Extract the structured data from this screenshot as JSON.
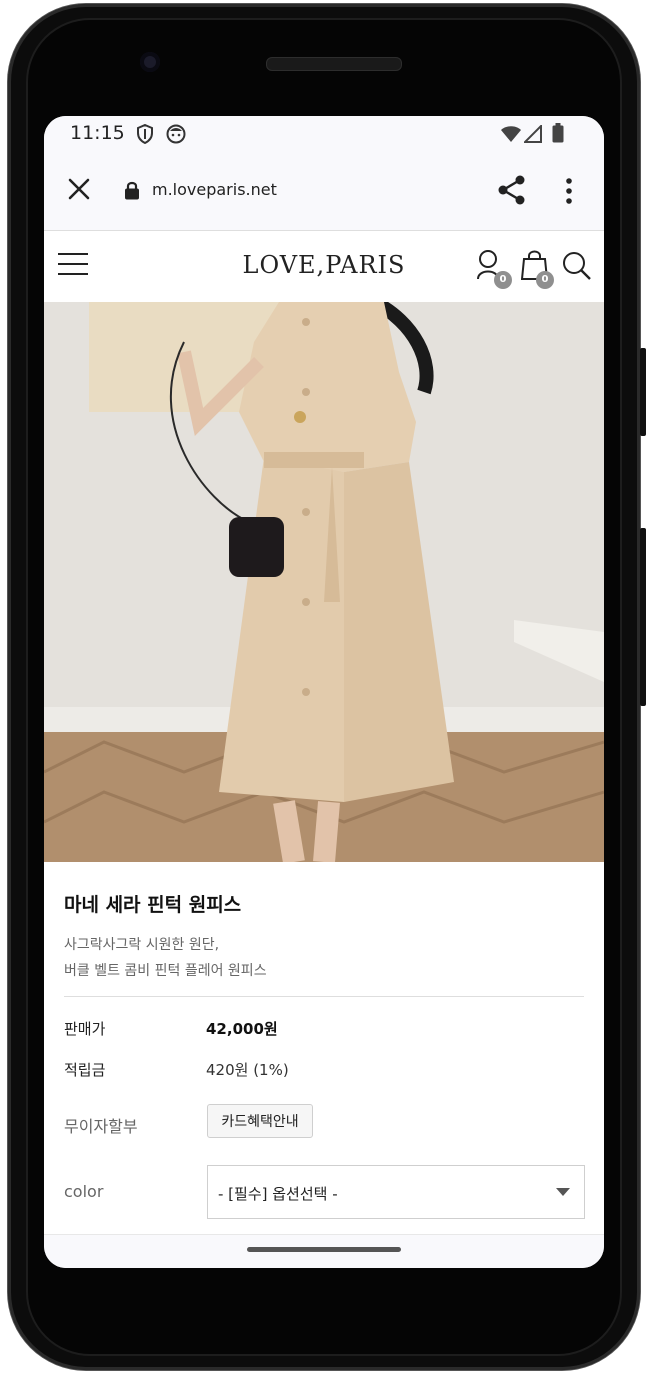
{
  "status_bar": {
    "time": "11:15"
  },
  "browser": {
    "url": "m.loveparis.net"
  },
  "site_header": {
    "logo": "LOVE,PARIS",
    "user_badge": "0",
    "cart_badge": "0"
  },
  "product": {
    "name": "마네 세라 핀턱 원피스",
    "description_lines": [
      "사그락사그락 시원한 원단,",
      "버클 벨트 콤비 핀턱 플레어 원피스"
    ],
    "price_label": "판매가",
    "price_value": "42,000원",
    "points_label": "적립금",
    "points_value": "420원 (1%)",
    "installment_label": "무이자할부",
    "card_button": "카드혜택안내",
    "color_label": "color",
    "color_select": "- [필수] 옵션선택 -"
  },
  "colors": {
    "dress": "#e5cfb1",
    "wall": "#e6e4df",
    "floor": "#b08e6c"
  }
}
